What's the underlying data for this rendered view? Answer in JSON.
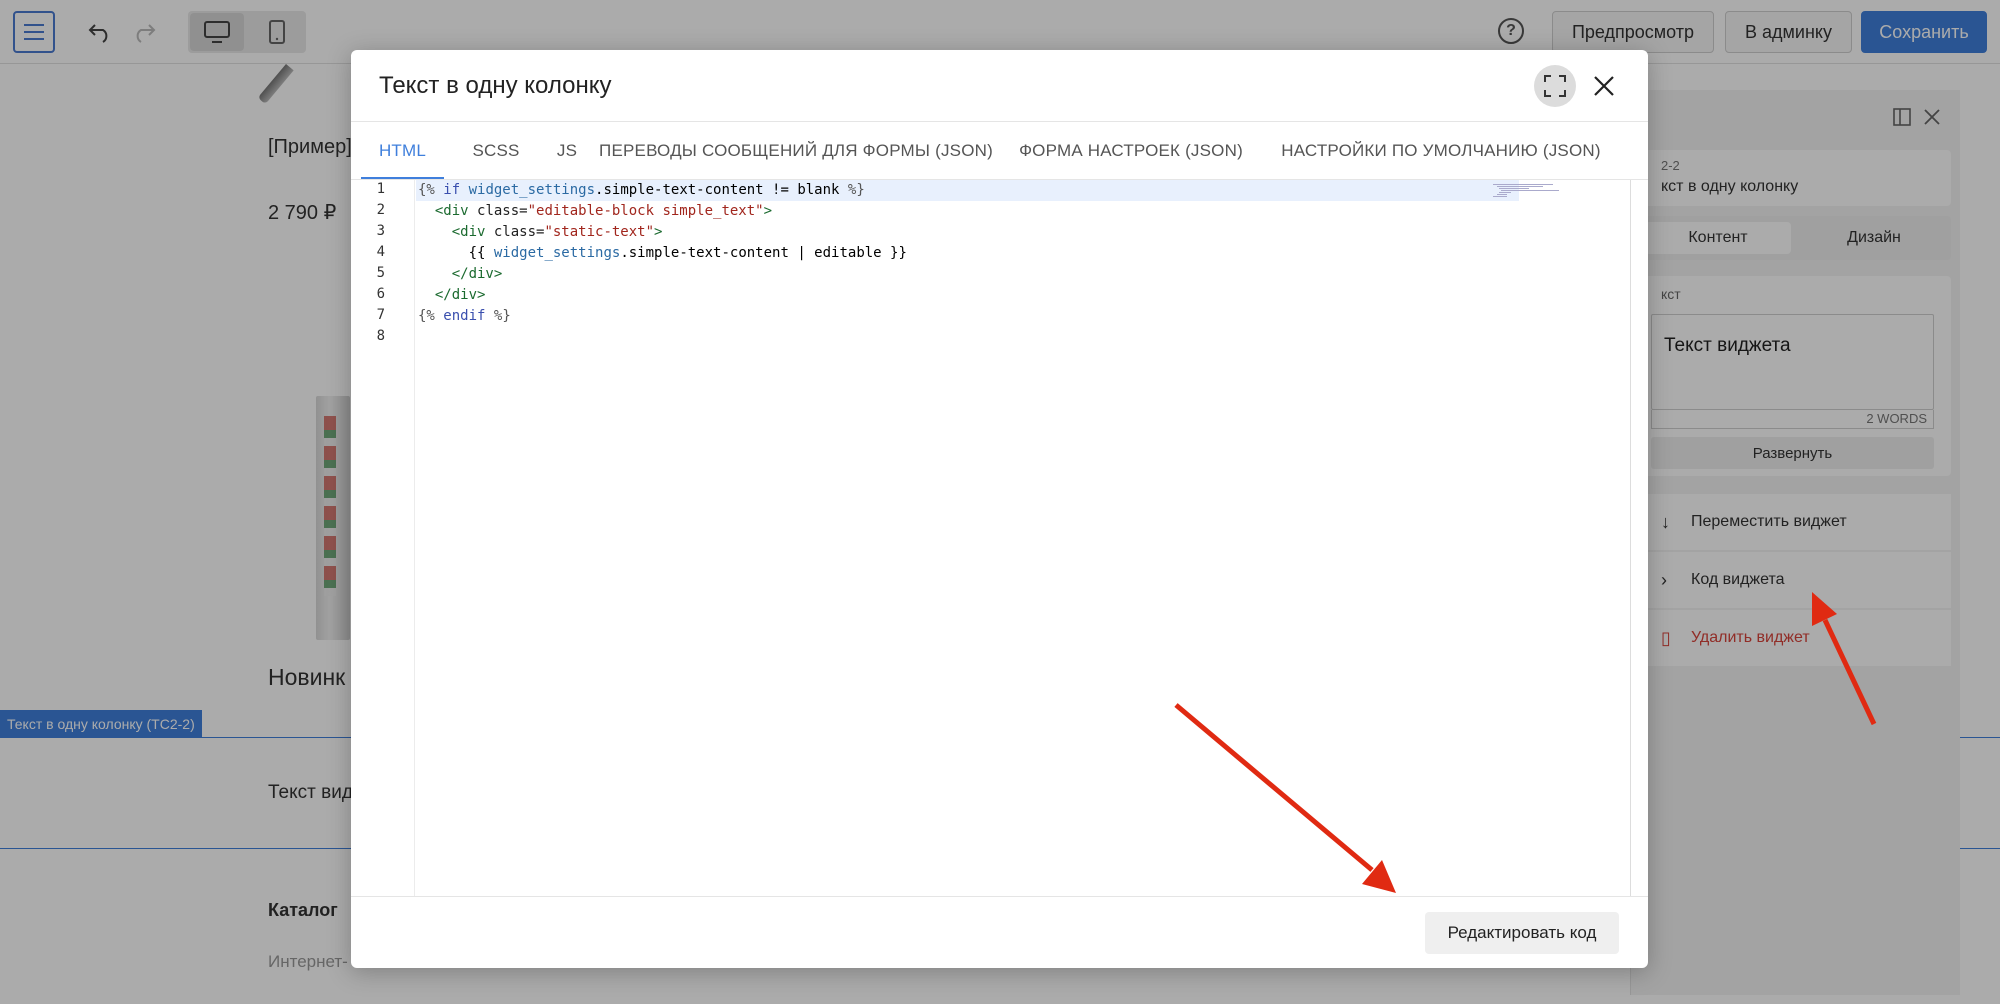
{
  "toolbar": {
    "preview_label": "Предпросмотр",
    "admin_label": "В админку",
    "save_label": "Сохранить"
  },
  "page": {
    "product_name": "[Пример]",
    "product_price": "2 790 ₽",
    "section_heading": "Новинк",
    "section_tag": "Текст в одну колонку (TC2-2)",
    "widget_text": "Текст вид",
    "footer_heading": "Каталог",
    "footer_text": "Интернет-"
  },
  "side_panel": {
    "widget_code": "2-2",
    "widget_name": "кст в одну колонку",
    "tabs": [
      {
        "label": "Контент"
      },
      {
        "label": "Дизайн"
      }
    ],
    "field_label": "кст",
    "field_value": "Текст виджета",
    "word_count": "2 WORDS",
    "expand_label": "Развернуть",
    "move_label": "Переместить виджет",
    "code_label": "Код виджета",
    "delete_label": "Удалить виджет"
  },
  "modal": {
    "title": "Текст в одну колонку",
    "tabs": [
      {
        "label": "HTML"
      },
      {
        "label": "SCSS"
      },
      {
        "label": "JS"
      },
      {
        "label": "ПЕРЕВОДЫ СООБЩЕНИЙ ДЛЯ ФОРМЫ (JSON)"
      },
      {
        "label": "ФОРМА НАСТРОЕК (JSON)"
      },
      {
        "label": "НАСТРОЙКИ ПО УМОЛЧАНИЮ (JSON)"
      }
    ],
    "line_numbers": [
      "1",
      "2",
      "3",
      "4",
      "5",
      "6",
      "7",
      "8"
    ],
    "code": {
      "l1_open": "{%",
      "l1_kw": "if",
      "l1_var": "widget_settings",
      "l1_rest": ".simple-text-content != blank",
      "l1_close": "%}",
      "l2_tag": "<div",
      "l2_attr": "class=",
      "l2_str": "\"editable-block simple_text\"",
      "l2_end": ">",
      "l3_tag": "<div",
      "l3_attr": "class=",
      "l3_str": "\"static-text\"",
      "l3_end": ">",
      "l4_open": "{{",
      "l4_var": "widget_settings",
      "l4_rest": ".simple-text-content | editable",
      "l4_close": "}}",
      "l5": "</div>",
      "l6": "</div>",
      "l7_open": "{%",
      "l7_kw": "endif",
      "l7_close": "%}"
    },
    "edit_button_label": "Редактировать код"
  },
  "colors": {
    "accent": "#3f7fdc",
    "danger": "#d8433b",
    "annotation_arrow": "#e02a12"
  }
}
